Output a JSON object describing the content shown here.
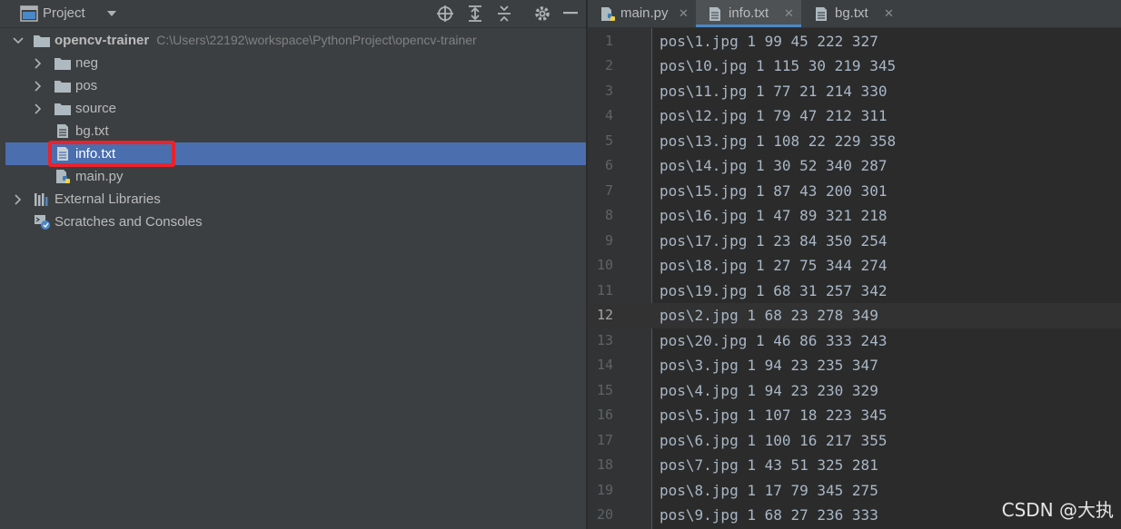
{
  "project_panel": {
    "title": "Project",
    "tree": {
      "root": {
        "name": "opencv-trainer",
        "path": "C:\\Users\\22192\\workspace\\PythonProject\\opencv-trainer"
      },
      "items": [
        {
          "label": "neg"
        },
        {
          "label": "pos"
        },
        {
          "label": "source"
        },
        {
          "label": "bg.txt"
        },
        {
          "label": "info.txt"
        },
        {
          "label": "main.py"
        }
      ],
      "external_libraries": "External Libraries",
      "scratches": "Scratches and Consoles"
    }
  },
  "tabs": [
    {
      "label": "main.py"
    },
    {
      "label": "info.txt"
    },
    {
      "label": "bg.txt"
    }
  ],
  "editor": {
    "current_line": 12,
    "lines": [
      {
        "num": "1",
        "text": "pos\\1.jpg 1 99 45 222 327"
      },
      {
        "num": "2",
        "text": "pos\\10.jpg 1 115 30 219 345"
      },
      {
        "num": "3",
        "text": "pos\\11.jpg 1 77 21 214 330"
      },
      {
        "num": "4",
        "text": "pos\\12.jpg 1 79 47 212 311"
      },
      {
        "num": "5",
        "text": "pos\\13.jpg 1 108 22 229 358"
      },
      {
        "num": "6",
        "text": "pos\\14.jpg 1 30 52 340 287"
      },
      {
        "num": "7",
        "text": "pos\\15.jpg 1 87 43 200 301"
      },
      {
        "num": "8",
        "text": "pos\\16.jpg 1 47 89 321 218"
      },
      {
        "num": "9",
        "text": "pos\\17.jpg 1 23 84 350 254"
      },
      {
        "num": "10",
        "text": "pos\\18.jpg 1 27 75 344 274"
      },
      {
        "num": "11",
        "text": "pos\\19.jpg 1 68 31 257 342"
      },
      {
        "num": "12",
        "text": "pos\\2.jpg 1 68 23 278 349"
      },
      {
        "num": "13",
        "text": "pos\\20.jpg 1 46 86 333 243"
      },
      {
        "num": "14",
        "text": "pos\\3.jpg 1 94 23 235 347"
      },
      {
        "num": "15",
        "text": "pos\\4.jpg 1 94 23 230 329"
      },
      {
        "num": "16",
        "text": "pos\\5.jpg 1 107 18 223 345"
      },
      {
        "num": "17",
        "text": "pos\\6.jpg 1 100 16 217 355"
      },
      {
        "num": "18",
        "text": "pos\\7.jpg 1 43 51 325 281"
      },
      {
        "num": "19",
        "text": "pos\\8.jpg 1 17 79 345 275"
      },
      {
        "num": "20",
        "text": "pos\\9.jpg 1 68 27 236 333"
      }
    ]
  },
  "watermark": "CSDN @大执",
  "colors": {
    "selection": "#4b6eaf",
    "highlight_box": "#e8232d",
    "editor_bg": "#2b2b2b",
    "panel_bg": "#3c3f41"
  }
}
